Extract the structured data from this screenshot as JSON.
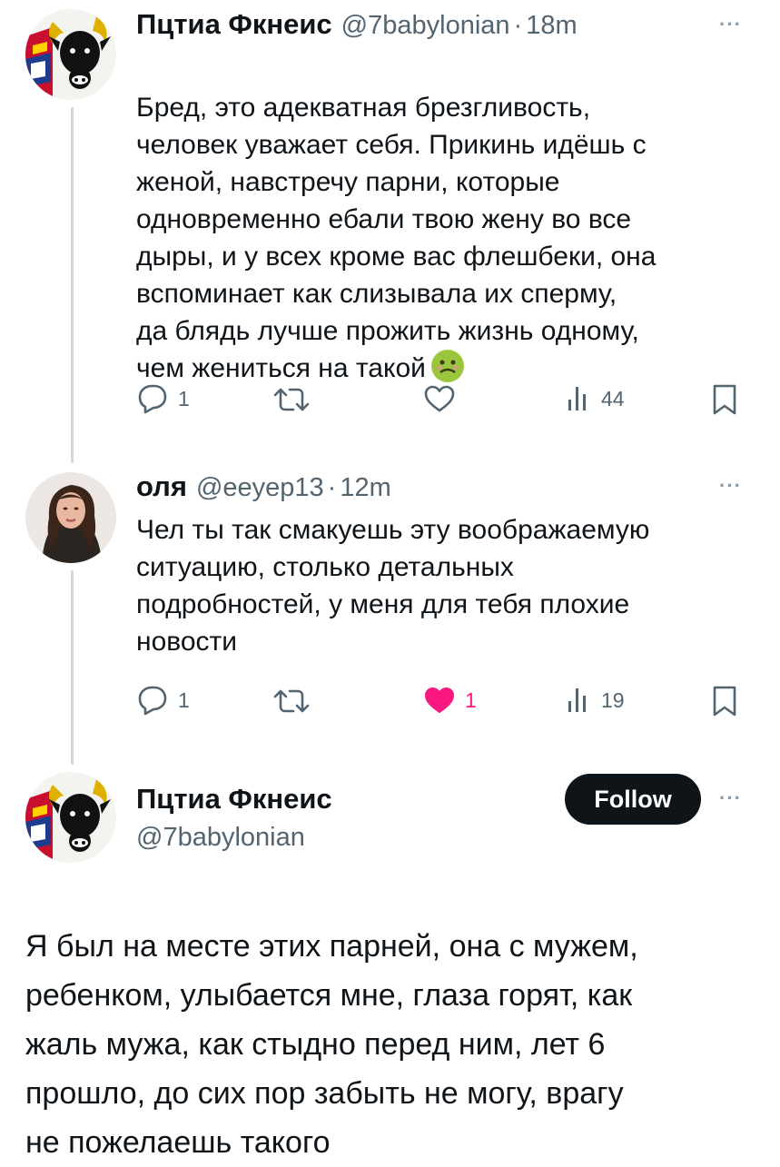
{
  "tweets": [
    {
      "author_name": "Пцтиа Фкнеис",
      "handle": "@7babylonian",
      "time": "18m",
      "text": "Бред, это адекватная брезгливость,\nчеловек уважает себя. Прикинь идёшь с\nженой, навстречу парни, которые\nодновременно ебали твою жену во все\nдыры, и у всех кроме вас флешбеки, она\nвспоминает как слизывала их сперму,\nда блядь лучше прожить жизнь одному,\nчем жениться на такой",
      "emoji": "nauseated-face-emoji",
      "replies": "1",
      "retweets": "",
      "likes": "",
      "views": "44"
    },
    {
      "author_name": "оля",
      "handle": "@eeyep13",
      "time": "12m",
      "text": "Чел ты так смакуешь эту воображаемую\nситуацию, столько детальных\nподробностей, у меня для тебя плохие\nновости",
      "replies": "1",
      "retweets": "",
      "likes": "1",
      "views": "19"
    }
  ],
  "main_tweet": {
    "author_name": "Пцтиа Фкнеис",
    "handle": "@7babylonian",
    "follow_label": "Follow",
    "text": "Я был на месте этих парней, она с мужем,\nребенком, улыбается мне, глаза горят, как\nжаль мужа, как стыдно перед ним, лет 6\nпрошло, до сих пор забыть не могу, врагу\nне пожелаешь такого"
  },
  "separator": "·",
  "more_glyph": "···",
  "colors": {
    "text": "#0f1419",
    "secondary": "#536471",
    "like": "#f91880",
    "thread_line": "#cfd9de",
    "follow_bg": "#0f1419"
  },
  "icons": [
    "bull-avatar-icon",
    "reply-icon",
    "retweet-icon",
    "like-icon",
    "views-icon",
    "bookmark-icon",
    "more-icon"
  ]
}
